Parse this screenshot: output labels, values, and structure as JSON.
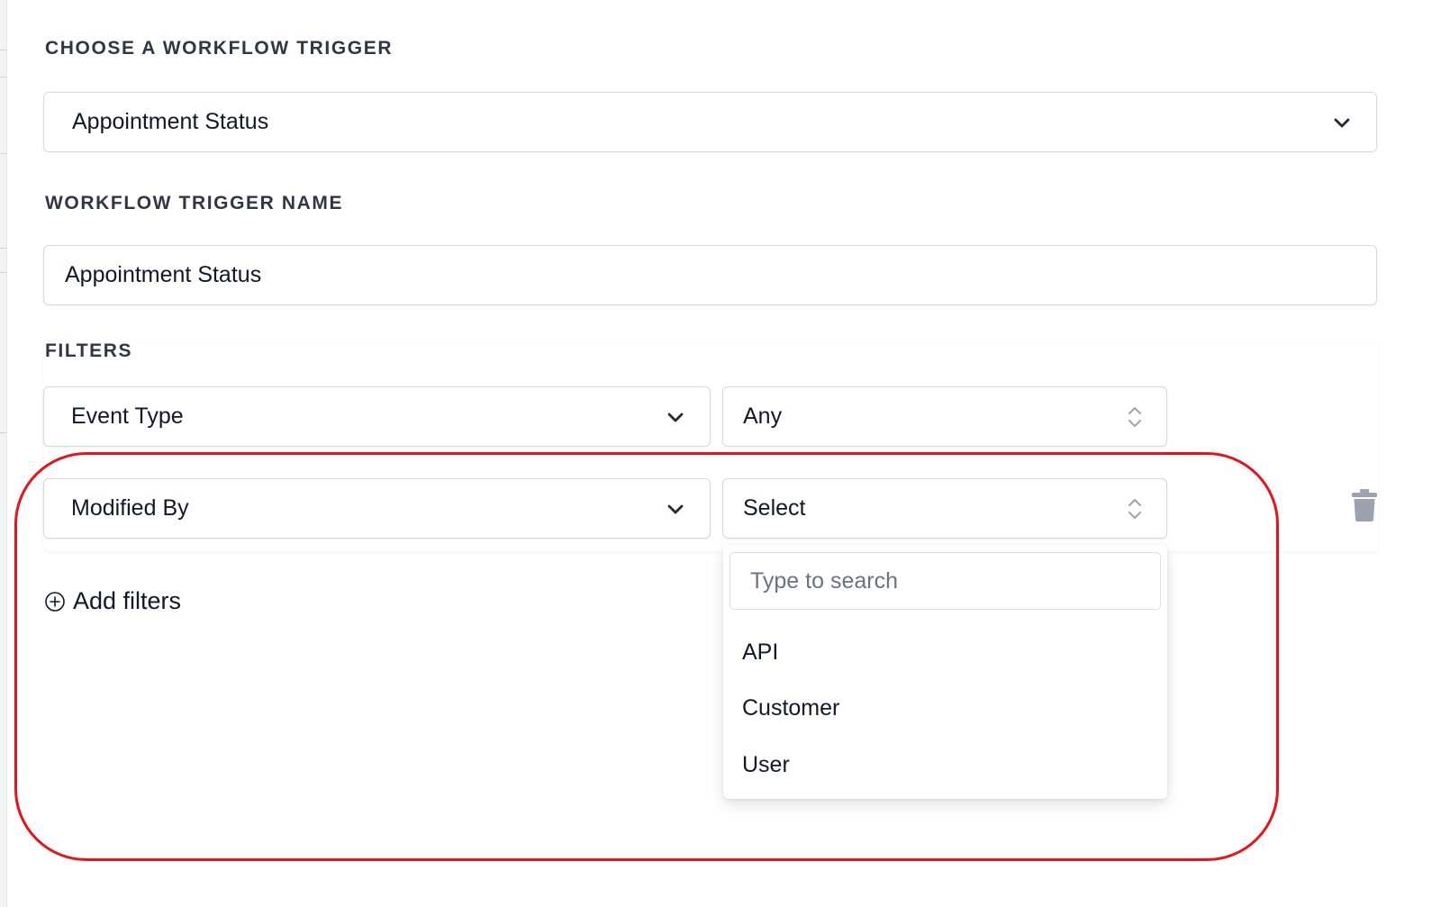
{
  "trigger": {
    "label": "CHOOSE A WORKFLOW TRIGGER",
    "selected": "Appointment Status"
  },
  "trigger_name": {
    "label": "WORKFLOW TRIGGER NAME",
    "value": "Appointment Status"
  },
  "filters": {
    "label": "FILTERS",
    "rows": [
      {
        "field": "Event Type",
        "value": "Any"
      },
      {
        "field": "Modified By",
        "value": "Select"
      }
    ],
    "add_label": "Add filters"
  },
  "value_dropdown": {
    "search_placeholder": "Type to search",
    "options": [
      "API",
      "Customer",
      "User"
    ]
  },
  "icons": {
    "trigger_select": "chevron-down-icon",
    "value_select": "up-down-chevrons-icon",
    "delete": "trash-icon",
    "add": "plus-circle-icon"
  },
  "colors": {
    "highlight": "#e5141b",
    "label_text": "#2f3744",
    "icon_gray": "#9ca3af"
  }
}
